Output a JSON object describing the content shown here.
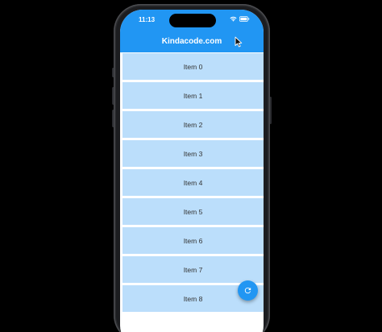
{
  "status_bar": {
    "time": "11:13",
    "icons": [
      "wifi-icon",
      "battery-icon"
    ]
  },
  "app_bar": {
    "title": "Kindacode.com",
    "color": "#2196f3"
  },
  "list": {
    "item_color": "#bbdefb",
    "items": [
      {
        "label": "Item 0"
      },
      {
        "label": "Item 1"
      },
      {
        "label": "Item 2"
      },
      {
        "label": "Item 3"
      },
      {
        "label": "Item 4"
      },
      {
        "label": "Item 5"
      },
      {
        "label": "Item 6"
      },
      {
        "label": "Item 7"
      },
      {
        "label": "Item 8"
      }
    ]
  },
  "fab": {
    "icon": "refresh-icon"
  }
}
